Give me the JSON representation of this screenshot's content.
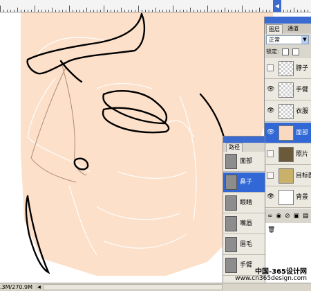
{
  "status": {
    "doc_size": ".3M/270.9M"
  },
  "watermark": {
    "line1": "中国-365设计网",
    "line2": "www.cn365design.com"
  },
  "layers_panel": {
    "tabs": [
      "图层",
      "通道"
    ],
    "blend_mode": "正常",
    "lock_label": "锁定:",
    "layers": [
      {
        "name": "脖子",
        "visible": false,
        "thumb": "transparent",
        "selected": false
      },
      {
        "name": "手臂",
        "visible": true,
        "thumb": "transparent",
        "selected": false
      },
      {
        "name": "衣服",
        "visible": true,
        "thumb": "transparent",
        "selected": false
      },
      {
        "name": "面部",
        "visible": true,
        "thumb": "skin",
        "selected": true
      },
      {
        "name": "照片",
        "visible": false,
        "thumb": "photo",
        "selected": false
      },
      {
        "name": "目标图",
        "visible": false,
        "thumb": "target",
        "selected": false
      },
      {
        "name": "背景",
        "visible": true,
        "thumb": "bg",
        "selected": false
      }
    ],
    "bottom_icons": "∞ ◉ ⊘ ▣ ▤ 🗑"
  },
  "paths_panel": {
    "tab_label": "路径",
    "paths": [
      {
        "name": "面部",
        "selected": false
      },
      {
        "name": "鼻子",
        "selected": true
      },
      {
        "name": "眼睛",
        "selected": false
      },
      {
        "name": "嘴唇",
        "selected": false
      },
      {
        "name": "眉毛",
        "selected": false
      },
      {
        "name": "手臂",
        "selected": false
      }
    ]
  },
  "colors": {
    "skin": "#fce0c9",
    "selection": "#3168d5",
    "titlebar": "#3b6bd1"
  }
}
